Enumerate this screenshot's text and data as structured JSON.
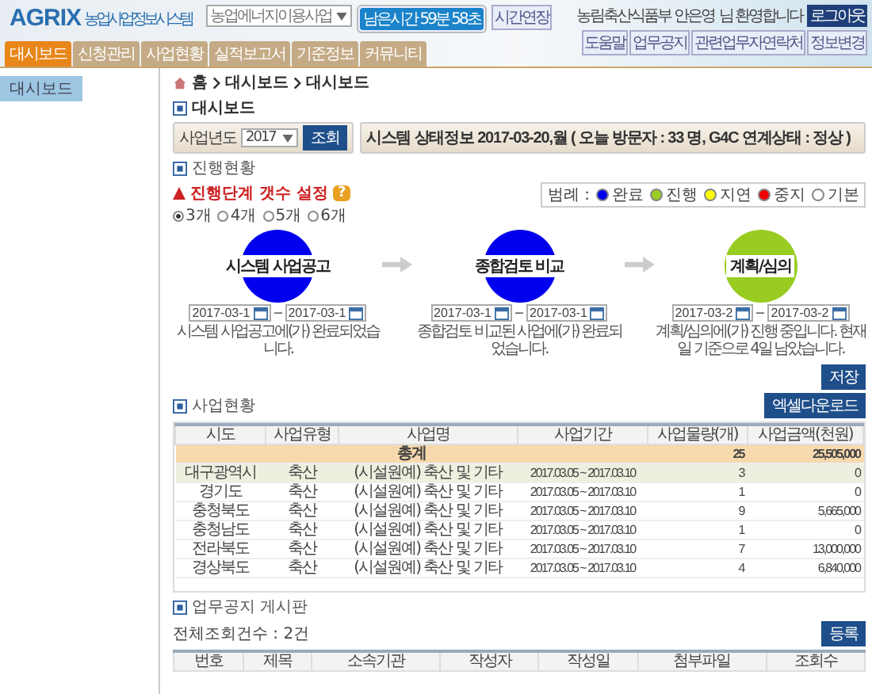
{
  "header": {
    "logo": "AGRIX",
    "logo_subtitle": "농업사업정보시스템",
    "project_select": "농업에너지이용사업",
    "session": {
      "label": "남은시간",
      "time": "59분 58초"
    },
    "extend_button": "시간연장",
    "user": "농림축산식품부 안은영",
    "welcome": "님 환영합니다",
    "logout": "로그아웃",
    "links": [
      "도움말",
      "업무공지",
      "관련업무자연락처",
      "정보변경"
    ]
  },
  "tabs": [
    {
      "label": "대시보드",
      "selected": true
    },
    {
      "label": "신청관리",
      "selected": false
    },
    {
      "label": "사업현황",
      "selected": false
    },
    {
      "label": "실적보고서",
      "selected": false
    },
    {
      "label": "기준정보",
      "selected": false
    },
    {
      "label": "커뮤니티",
      "selected": false
    }
  ],
  "sidebar": {
    "items": [
      {
        "label": "대시보드",
        "selected": true
      }
    ]
  },
  "breadcrumb": [
    "홈",
    "대시보드",
    "대시보드"
  ],
  "page_title": "대시보드",
  "filter": {
    "label": "사업년도",
    "year": "2017",
    "search_button": "조회"
  },
  "status": "시스템 상태정보 2017-03-20,월 ( 오늘 방문자 : 33 명, G4C 연계상태 : 정상 )",
  "progress": {
    "title": "진행현황",
    "step_label": "진행단계 갯수 설정",
    "help": "?",
    "step_options": [
      {
        "label": "3개",
        "selected": true
      },
      {
        "label": "4개",
        "selected": false
      },
      {
        "label": "5개",
        "selected": false
      },
      {
        "label": "6개",
        "selected": false
      }
    ],
    "legend_label": "범례 :",
    "legend": [
      {
        "label": "완료",
        "color": "#0000ee"
      },
      {
        "label": "진행",
        "color": "#99cc22"
      },
      {
        "label": "지연",
        "color": "#ffff00"
      },
      {
        "label": "중지",
        "color": "#ee0000"
      },
      {
        "label": "기본",
        "color": "#ffffff"
      }
    ],
    "stages": [
      {
        "name": "시스템 사업공고",
        "color": "#0000ee",
        "start": "2017-03-1",
        "end": "2017-03-1",
        "note": "시스템 사업공고에(가) 완료되었습니다."
      },
      {
        "name": "종합검토 비교",
        "color": "#0000ee",
        "start": "2017-03-1",
        "end": "2017-03-1",
        "note": "종합검토 비교된 사업에(가) 완료되었습니다."
      },
      {
        "name": "계획/심의",
        "color": "#99cc22",
        "start": "2017-03-2",
        "end": "2017-03-2",
        "note": "계획/심의에(가) 진행 중입니다. 현재일 기준으로 4일 남았습니다."
      }
    ],
    "save_button": "저장"
  },
  "business": {
    "title": "사업현황",
    "excel_button": "엑셀다운로드",
    "columns": [
      "시도",
      "사업유형",
      "사업명",
      "사업기간",
      "사업물량(개)",
      "사업금액(천원)"
    ],
    "total": {
      "label": "총계",
      "count": "25",
      "amount": "25,505,000"
    },
    "rows": [
      [
        "대구광역시",
        "축산",
        "(시설원예) 축산 및 기타",
        "2017.03.05 ~ 2017.03.10",
        "3",
        "0"
      ],
      [
        "경기도",
        "축산",
        "(시설원예) 축산 및 기타",
        "2017.03.05 ~ 2017.03.10",
        "1",
        "0"
      ],
      [
        "충청북도",
        "축산",
        "(시설원예) 축산 및 기타",
        "2017.03.05 ~ 2017.03.10",
        "9",
        "5,665,000"
      ],
      [
        "충청남도",
        "축산",
        "(시설원예) 축산 및 기타",
        "2017.03.05 ~ 2017.03.10",
        "1",
        "0"
      ],
      [
        "전라북도",
        "축산",
        "(시설원예) 축산 및 기타",
        "2017.03.05 ~ 2017.03.10",
        "7",
        "13,000,000"
      ],
      [
        "경상북도",
        "축산",
        "(시설원예) 축산 및 기타",
        "2017.03.05 ~ 2017.03.10",
        "4",
        "6,840,000"
      ]
    ]
  },
  "board": {
    "title": "업무공지 게시판",
    "count": "전체조회건수 : 2건",
    "register_button": "등록",
    "columns": [
      "번호",
      "제목",
      "소속기관",
      "작성자",
      "작성일",
      "첨부파일",
      "조회수"
    ]
  }
}
